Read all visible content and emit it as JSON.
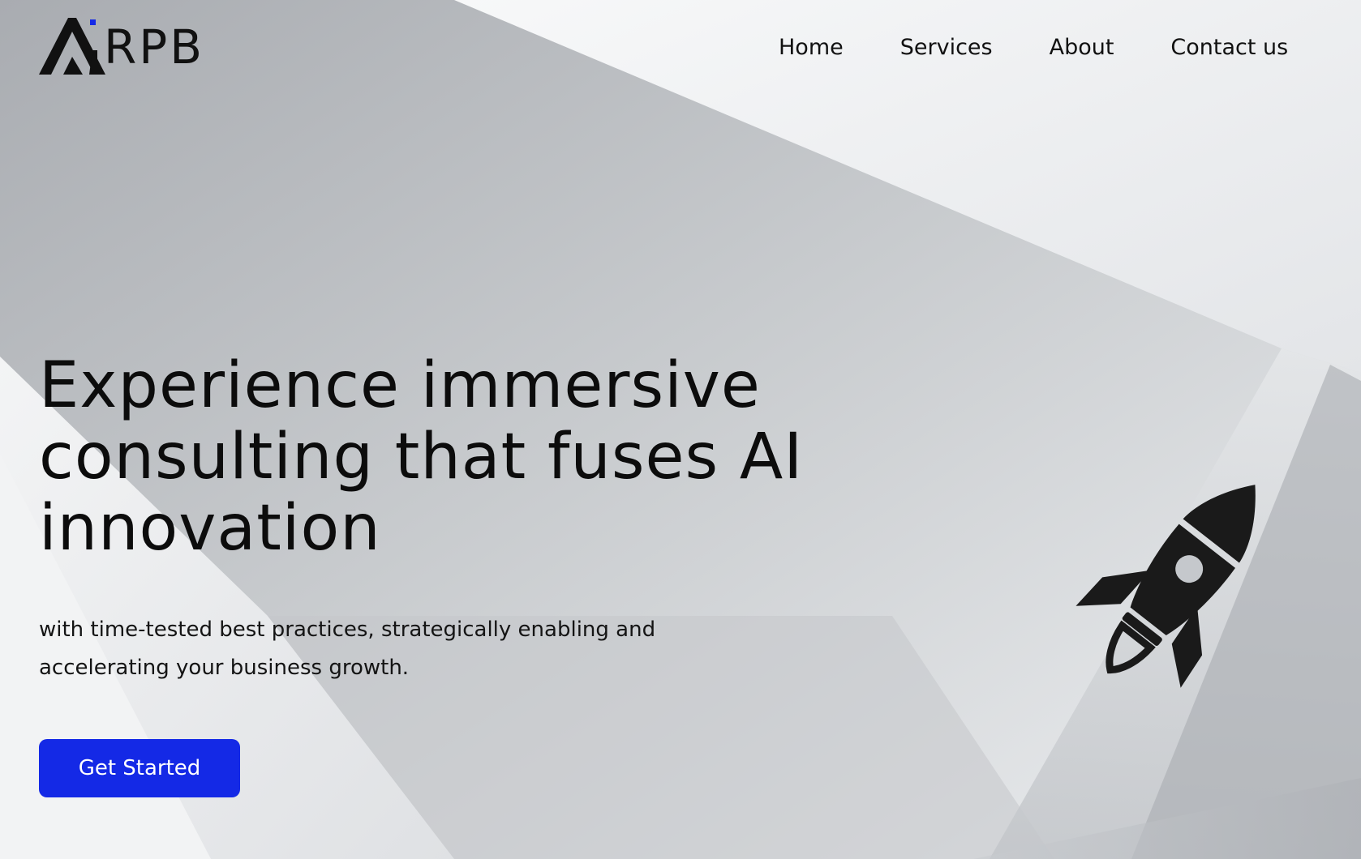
{
  "brand": {
    "logo_text": "RPB",
    "logo_mark": "AI",
    "accent_color": "#1429e6"
  },
  "nav": {
    "home": "Home",
    "services": "Services",
    "about": "About",
    "contact": "Contact us"
  },
  "hero": {
    "title": "Experience immersive consulting that fuses AI innovation",
    "subtitle": "with time-tested best practices, strategically enabling and accelerating your business growth.",
    "cta_label": "Get Started"
  },
  "icons": {
    "logo": "airpb-logo-icon",
    "rocket": "rocket-icon"
  },
  "colors": {
    "text": "#0c0c0c",
    "button_bg": "#1429e6",
    "button_text": "#ffffff"
  }
}
